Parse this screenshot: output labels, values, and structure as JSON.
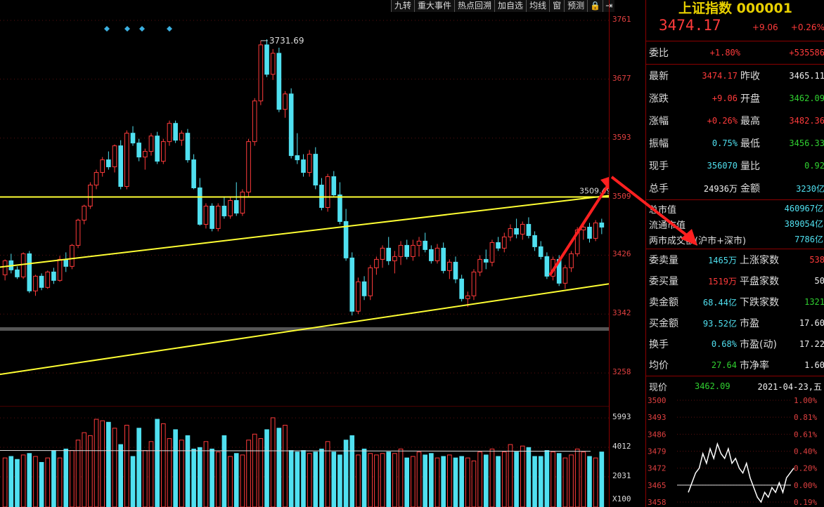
{
  "toolbar": {
    "buttons": [
      "九转",
      "重大事件",
      "热点回溯",
      "加自选",
      "均线",
      "窗",
      "预测"
    ],
    "icons": [
      "lock-icon",
      "exit-icon"
    ],
    "icon_glyphs": [
      "🔒",
      "⇥"
    ]
  },
  "axis": {
    "price_ticks": [
      "3761",
      "3677",
      "3593",
      "3509",
      "3426",
      "3342",
      "3258"
    ],
    "volume_ticks": [
      "5993",
      "4012",
      "2031",
      "X100"
    ]
  },
  "annotations": {
    "high_label": "3731.69",
    "line_label": "3509.49"
  },
  "chart_data": {
    "type": "candlestick",
    "y_range": [
      3212,
      3790
    ],
    "up_color": "#ff3b3b",
    "down_color": "#50e0f0",
    "candles": [
      [
        3398,
        3420,
        3390,
        3418
      ],
      [
        3418,
        3428,
        3400,
        3405
      ],
      [
        3405,
        3410,
        3392,
        3395
      ],
      [
        3395,
        3430,
        3392,
        3428
      ],
      [
        3428,
        3432,
        3372,
        3375
      ],
      [
        3375,
        3398,
        3368,
        3396
      ],
      [
        3396,
        3400,
        3376,
        3380
      ],
      [
        3380,
        3404,
        3378,
        3402
      ],
      [
        3402,
        3408,
        3385,
        3390
      ],
      [
        3390,
        3425,
        3388,
        3420
      ],
      [
        3420,
        3430,
        3402,
        3410
      ],
      [
        3410,
        3442,
        3406,
        3440
      ],
      [
        3440,
        3478,
        3436,
        3476
      ],
      [
        3476,
        3498,
        3470,
        3496
      ],
      [
        3496,
        3530,
        3492,
        3526
      ],
      [
        3526,
        3548,
        3520,
        3544
      ],
      [
        3544,
        3566,
        3538,
        3562
      ],
      [
        3562,
        3574,
        3548,
        3552
      ],
      [
        3552,
        3584,
        3544,
        3582
      ],
      [
        3582,
        3590,
        3520,
        3524
      ],
      [
        3524,
        3604,
        3520,
        3600
      ],
      [
        3600,
        3610,
        3582,
        3586
      ],
      [
        3586,
        3592,
        3560,
        3566
      ],
      [
        3566,
        3578,
        3548,
        3574
      ],
      [
        3574,
        3600,
        3568,
        3596
      ],
      [
        3596,
        3602,
        3556,
        3560
      ],
      [
        3560,
        3592,
        3556,
        3588
      ],
      [
        3588,
        3618,
        3582,
        3614
      ],
      [
        3614,
        3618,
        3586,
        3590
      ],
      [
        3590,
        3604,
        3582,
        3600
      ],
      [
        3600,
        3606,
        3558,
        3562
      ],
      [
        3562,
        3570,
        3520,
        3522
      ],
      [
        3522,
        3536,
        3468,
        3470
      ],
      [
        3470,
        3500,
        3464,
        3496
      ],
      [
        3496,
        3500,
        3460,
        3464
      ],
      [
        3464,
        3500,
        3460,
        3496
      ],
      [
        3496,
        3510,
        3478,
        3482
      ],
      [
        3482,
        3510,
        3478,
        3504
      ],
      [
        3504,
        3530,
        3482,
        3486
      ],
      [
        3486,
        3520,
        3482,
        3516
      ],
      [
        3516,
        3592,
        3510,
        3588
      ],
      [
        3588,
        3650,
        3582,
        3646
      ],
      [
        3646,
        3732,
        3640,
        3726
      ],
      [
        3726,
        3734,
        3680,
        3684
      ],
      [
        3684,
        3720,
        3676,
        3714
      ],
      [
        3714,
        3722,
        3630,
        3634
      ],
      [
        3634,
        3660,
        3622,
        3656
      ],
      [
        3656,
        3664,
        3564,
        3568
      ],
      [
        3568,
        3600,
        3556,
        3562
      ],
      [
        3562,
        3570,
        3538,
        3544
      ],
      [
        3544,
        3576,
        3538,
        3570
      ],
      [
        3570,
        3580,
        3520,
        3526
      ],
      [
        3526,
        3536,
        3490,
        3494
      ],
      [
        3494,
        3542,
        3488,
        3538
      ],
      [
        3538,
        3546,
        3508,
        3512
      ],
      [
        3512,
        3530,
        3470,
        3474
      ],
      [
        3474,
        3492,
        3418,
        3422
      ],
      [
        3422,
        3430,
        3340,
        3346
      ],
      [
        3346,
        3394,
        3342,
        3388
      ],
      [
        3388,
        3396,
        3362,
        3368
      ],
      [
        3368,
        3412,
        3362,
        3408
      ],
      [
        3408,
        3424,
        3398,
        3420
      ],
      [
        3420,
        3440,
        3408,
        3436
      ],
      [
        3436,
        3452,
        3412,
        3418
      ],
      [
        3418,
        3432,
        3400,
        3424
      ],
      [
        3424,
        3446,
        3412,
        3440
      ],
      [
        3440,
        3448,
        3420,
        3424
      ],
      [
        3424,
        3448,
        3418,
        3440
      ],
      [
        3440,
        3452,
        3424,
        3446
      ],
      [
        3446,
        3458,
        3430,
        3434
      ],
      [
        3434,
        3440,
        3414,
        3418
      ],
      [
        3418,
        3442,
        3414,
        3436
      ],
      [
        3436,
        3444,
        3400,
        3404
      ],
      [
        3404,
        3420,
        3392,
        3416
      ],
      [
        3416,
        3424,
        3386,
        3392
      ],
      [
        3392,
        3398,
        3360,
        3364
      ],
      [
        3364,
        3374,
        3352,
        3368
      ],
      [
        3368,
        3406,
        3362,
        3402
      ],
      [
        3402,
        3426,
        3396,
        3420
      ],
      [
        3420,
        3434,
        3406,
        3416
      ],
      [
        3416,
        3448,
        3410,
        3444
      ],
      [
        3444,
        3452,
        3432,
        3436
      ],
      [
        3436,
        3458,
        3430,
        3452
      ],
      [
        3452,
        3470,
        3446,
        3464
      ],
      [
        3464,
        3478,
        3450,
        3456
      ],
      [
        3456,
        3474,
        3448,
        3470
      ],
      [
        3470,
        3480,
        3450,
        3454
      ],
      [
        3454,
        3460,
        3432,
        3438
      ],
      [
        3438,
        3446,
        3420,
        3424
      ],
      [
        3424,
        3430,
        3392,
        3396
      ],
      [
        3396,
        3424,
        3390,
        3420
      ],
      [
        3420,
        3426,
        3382,
        3386
      ],
      [
        3386,
        3412,
        3378,
        3408
      ],
      [
        3408,
        3432,
        3402,
        3428
      ],
      [
        3428,
        3466,
        3424,
        3462
      ],
      [
        3462,
        3474,
        3448,
        3466
      ],
      [
        3466,
        3472,
        3444,
        3450
      ],
      [
        3450,
        3476,
        3446,
        3472
      ],
      [
        3472,
        3478,
        3456,
        3466
      ]
    ],
    "volume": [
      3300,
      3400,
      3200,
      3500,
      3600,
      3400,
      3000,
      3300,
      3800,
      3300,
      3900,
      3800,
      4500,
      5000,
      4800,
      5900,
      5800,
      5700,
      5300,
      4200,
      5500,
      3400,
      5300,
      3800,
      4400,
      5900,
      5600,
      4600,
      5200,
      4500,
      4800,
      3900,
      4000,
      4400,
      3900,
      3700,
      4800,
      3400,
      3600,
      3500,
      4500,
      4900,
      4600,
      5200,
      6000,
      5300,
      5500,
      3800,
      3700,
      3800,
      3600,
      3700,
      3900,
      4400,
      3700,
      3500,
      4500,
      4800,
      3500,
      3900,
      3600,
      3500,
      3600,
      3700,
      3600,
      3900,
      3300,
      3400,
      3700,
      3500,
      3600,
      3300,
      3400,
      3500,
      3300,
      3400,
      3300,
      3100,
      3700,
      3500,
      3900,
      3400,
      3700,
      4200,
      3700,
      4100,
      4000,
      3400,
      3400,
      3800,
      3700,
      3600,
      3300,
      3500,
      3900,
      3700,
      3400,
      3300,
      3700
    ],
    "volume_range": [
      0,
      6800
    ],
    "upper_line": {
      "from": [
        0,
        3509
      ],
      "to": [
        1,
        3509
      ]
    },
    "channel_upper": {
      "from": [
        0,
        3409
      ],
      "to": [
        1,
        3511
      ]
    },
    "channel_lower": {
      "from": [
        0,
        3256
      ],
      "to": [
        1,
        3385
      ]
    },
    "marker_count": 4
  },
  "panel": {
    "title": "上证指数 000001",
    "price": "3474.17",
    "change": "+9.06",
    "change_pct": "+0.26%",
    "weibi_label": "委比",
    "weibi_pct": "+1.80%",
    "weibi_val": "+535586",
    "rows1": [
      {
        "l1": "最新",
        "v1": "3474.17",
        "c1": "red",
        "l2": "昨收",
        "v2": "3465.11",
        "c2": "white"
      },
      {
        "l1": "涨跌",
        "v1": "+9.06",
        "c1": "red",
        "l2": "开盘",
        "v2": "3462.09",
        "c2": "green"
      },
      {
        "l1": "涨幅",
        "v1": "+0.26%",
        "c1": "red",
        "l2": "最高",
        "v2": "3482.36",
        "c2": "red"
      },
      {
        "l1": "振幅",
        "v1": "0.75%",
        "c1": "cyan",
        "l2": "最低",
        "v2": "3456.33",
        "c2": "green"
      },
      {
        "l1": "现手",
        "v1": "356070",
        "c1": "cyan",
        "l2": "量比",
        "v2": "0.92",
        "c2": "green"
      },
      {
        "l1": "总手",
        "v1": "24936万",
        "c1": "white",
        "l2": "金额",
        "v2": "3230亿",
        "c2": "cyan"
      }
    ],
    "mkt_total_label": "总市值",
    "mkt_total": "460967亿",
    "mkt_float_label": "流通市值",
    "mkt_float": "389054亿",
    "turnover_label": "两市成交额(沪市+深市)",
    "turnover": "7786亿",
    "rows2": [
      {
        "l1": "委卖量",
        "v1": "1465万",
        "c1": "cyan",
        "l2": "上涨家数",
        "v2": "538",
        "c2": "red"
      },
      {
        "l1": "委买量",
        "v1": "1519万",
        "c1": "red",
        "l2": "平盘家数",
        "v2": "50",
        "c2": "white"
      },
      {
        "l1": "卖金额",
        "v1": "68.44亿",
        "c1": "cyan",
        "l2": "下跌家数",
        "v2": "1321",
        "c2": "green"
      },
      {
        "l1": "买金额",
        "v1": "93.52亿",
        "c1": "cyan",
        "l2": "市盈",
        "v2": "17.60",
        "c2": "white"
      },
      {
        "l1": "换手",
        "v1": "0.68%",
        "c1": "cyan",
        "l2": "市盈(动)",
        "v2": "17.22",
        "c2": "white"
      },
      {
        "l1": "均价",
        "v1": "27.64",
        "c1": "green",
        "l2": "市净率",
        "v2": "1.60",
        "c2": "white"
      }
    ],
    "current_label": "现价",
    "current_val": "3462.09",
    "date": "2021-04-23,五",
    "mini_left": [
      "3500",
      "3493",
      "3486",
      "3479",
      "3472",
      "3465",
      "3458"
    ],
    "mini_right": [
      "1.00%",
      "0.81%",
      "0.61%",
      "0.40%",
      "0.20%",
      "0.00%",
      "0.19%"
    ],
    "mini_series": [
      3462,
      3466,
      3470,
      3472,
      3478,
      3474,
      3480,
      3476,
      3482,
      3478,
      3476,
      3480,
      3474,
      3476,
      3472,
      3470,
      3474,
      3468,
      3464,
      3460,
      3458,
      3462,
      3460,
      3464,
      3462,
      3466,
      3462,
      3468,
      3470,
      3472
    ]
  }
}
